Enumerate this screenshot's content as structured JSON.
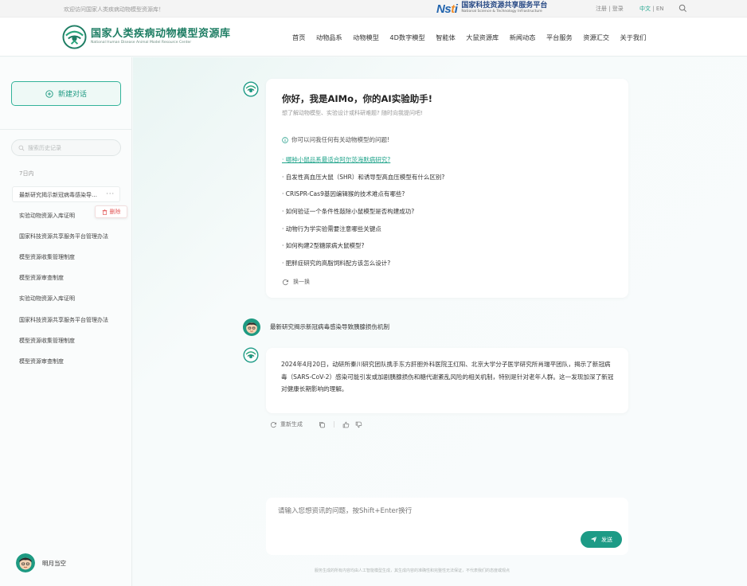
{
  "topbar": {
    "welcome": "欢迎访问国家人类疾病动物模型资源库！",
    "partner_logo": "Nsti",
    "partner_cn": "国家科技资源共享服务平台",
    "partner_en": "National Science & Technology Infrastructure",
    "auth": "注册 | 登录",
    "lang_cn": "中文",
    "lang_sep": " | ",
    "lang_en": "EN",
    "search_icon": "search-icon"
  },
  "brand": {
    "name_cn": "国家人类疾病动物模型资源库",
    "name_en": "National Human Disease Animal Model Resource Center"
  },
  "nav": [
    "首页",
    "动物品系",
    "动物模型",
    "4D数字模型",
    "智能体",
    "大鼠资源库",
    "新闻动态",
    "平台服务",
    "资源汇交",
    "关于我们"
  ],
  "sidebar": {
    "new_chat": "新建对话",
    "search_placeholder": "搜索历史记录",
    "group_label": "7日内",
    "active_item": "最新研究揭示新冠病毒感染导致胰腺损伤机制",
    "more": "···",
    "delete_label": "删除",
    "items": [
      "实验动物资源入库证明",
      "国家科技资源共享服务平台管理办法",
      "模型资源收集管理制度",
      "模型资源审查制度",
      "实验动物资源入库证明",
      "国家科技资源共享服务平台管理办法",
      "模型资源收集管理制度",
      "模型资源审查制度"
    ],
    "user_name": "明月当空"
  },
  "greeting": {
    "title": "你好，我是AIMo，你的AI实验助手!",
    "subtitle": "想了解动物模型、实验设计或科研难题? 随时向我提问吧!",
    "tip": "你可以问我任何有关动物模型的问题!",
    "questions": [
      "· 哪种小鼠品系最适合阿尔茨海默病研究?",
      "· 自发性高血压大鼠（SHR）和诱导型高血压模型有什么区别?",
      "· CRISPR-Cas9基因编辑猴的技术难点有哪些?",
      "· 如何验证一个条件性敲除小鼠模型是否构建成功?",
      "· 动物行为学实验需要注意哪些关键点",
      "· 如何构建2型糖尿病大鼠模型?",
      "· 肥胖症研究的高脂饲料配方该怎么设计?"
    ],
    "refresh": "换一换"
  },
  "conversation": {
    "user_message": "最新研究揭示新冠病毒感染导致胰腺损伤机制",
    "answer": "2024年4月20日，动研所秦川研究团队携手东方肝胆外科医院王红阳、北京大学分子医学研究所肖瑞平团队，揭示了新冠病毒（SARS-CoV-2）感染可能引发或加剧胰腺损伤和糖代谢紊乱风险的相关机制，特别是针对老年人群。这一发现加深了新冠对健康长期影响的理解。",
    "regenerate": "重新生成"
  },
  "composer": {
    "placeholder": "请输入您想资讯的问题，按Shift+Enter换行",
    "send": "发送"
  },
  "disclaimer": "服务生成的所有内容均由人工智能模型生成，其生成内容的准确性和完整性无法保证，不代表我们的态度或观点",
  "colors": {
    "accent": "#1d9b86",
    "link": "#1fa38a",
    "danger": "#e35a5a"
  }
}
